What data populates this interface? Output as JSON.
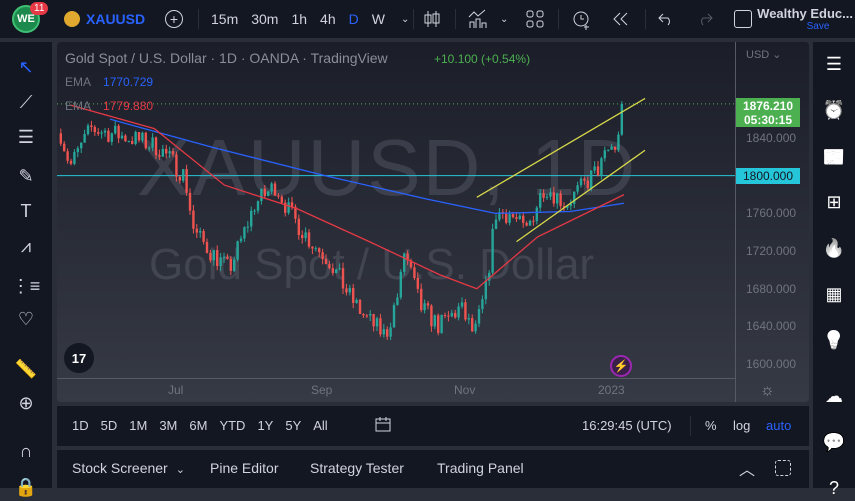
{
  "topbar": {
    "notification_count": "11",
    "symbol": "XAUUSD",
    "intervals": [
      "15m",
      "30m",
      "1h",
      "4h",
      "D",
      "W"
    ],
    "active_interval": "D",
    "account": "Wealthy Educ...",
    "save": "Save"
  },
  "legend": {
    "title": "Gold Spot / U.S. Dollar · 1D · OANDA · TradingView",
    "change": "+10.100 (+0.54%)",
    "ema1_label": "EMA",
    "ema1_value": "1770.729",
    "ema2_label": "EMA",
    "ema2_value": "1779.880"
  },
  "watermark": {
    "symbol": "XAUUSD, 1D",
    "name": "Gold Spot / U.S. Dollar"
  },
  "price_axis": {
    "currency": "USD",
    "current_price": "1876.210",
    "countdown": "05:30:15",
    "hline_label": "1800.000",
    "ticks": [
      "1840.000",
      "1760.000",
      "1720.000",
      "1680.000",
      "1640.000",
      "1600.000"
    ]
  },
  "time_axis": {
    "ticks": [
      "Jul",
      "Sep",
      "Nov",
      "2023"
    ]
  },
  "range_bar": {
    "ranges": [
      "1D",
      "5D",
      "1M",
      "3M",
      "6M",
      "YTD",
      "1Y",
      "5Y",
      "All"
    ],
    "clock": "16:29:45 (UTC)",
    "percent": "%",
    "log": "log",
    "auto": "auto"
  },
  "bottom_tabs": [
    "Stock Screener",
    "Pine Editor",
    "Strategy Tester",
    "Trading Panel"
  ],
  "colors": {
    "up": "#26a69a",
    "down": "#ef5350",
    "ema1": "#2962ff",
    "ema2": "#e53945",
    "channel": "#d8d84a",
    "hline": "#26c6da",
    "accent": "#2962ff",
    "price_badge": "#4caf50"
  },
  "chart_data": {
    "type": "candlestick",
    "symbol": "XAUUSD",
    "timeframe": "1D",
    "ylim": [
      1600,
      1890
    ],
    "approx_close_path": [
      [
        "2022-05-11",
        1845
      ],
      [
        "2022-05-15",
        1810
      ],
      [
        "2022-05-24",
        1850
      ],
      [
        "2022-06-10",
        1840
      ],
      [
        "2022-06-22",
        1830
      ],
      [
        "2022-07-03",
        1800
      ],
      [
        "2022-07-07",
        1740
      ],
      [
        "2022-07-14",
        1720
      ],
      [
        "2022-07-22",
        1700
      ],
      [
        "2022-07-27",
        1730
      ],
      [
        "2022-08-02",
        1770
      ],
      [
        "2022-08-11",
        1790
      ],
      [
        "2022-08-17",
        1760
      ],
      [
        "2022-08-26",
        1730
      ],
      [
        "2022-09-03",
        1710
      ],
      [
        "2022-09-12",
        1670
      ],
      [
        "2022-09-18",
        1650
      ],
      [
        "2022-09-27",
        1630
      ],
      [
        "2022-10-03",
        1680
      ],
      [
        "2022-10-05",
        1720
      ],
      [
        "2022-10-12",
        1660
      ],
      [
        "2022-10-20",
        1640
      ],
      [
        "2022-10-29",
        1660
      ],
      [
        "2022-11-04",
        1630
      ],
      [
        "2022-11-09",
        1680
      ],
      [
        "2022-11-13",
        1760
      ],
      [
        "2022-11-19",
        1760
      ],
      [
        "2022-11-26",
        1740
      ],
      [
        "2022-12-04",
        1790
      ],
      [
        "2022-12-13",
        1770
      ],
      [
        "2022-12-21",
        1790
      ],
      [
        "2022-12-28",
        1810
      ],
      [
        "2023-01-01",
        1830
      ],
      [
        "2023-01-04",
        1830
      ],
      [
        "2023-01-07",
        1876.21
      ]
    ],
    "ema_slow": [
      [
        "2022-06-01",
        1860
      ],
      [
        "2022-07-15",
        1830
      ],
      [
        "2022-09-01",
        1800
      ],
      [
        "2022-10-15",
        1775
      ],
      [
        "2022-11-13",
        1760
      ],
      [
        "2022-12-15",
        1762
      ],
      [
        "2023-01-07",
        1770.729
      ]
    ],
    "ema_fast": [
      [
        "2022-05-15",
        1875
      ],
      [
        "2022-06-20",
        1850
      ],
      [
        "2022-07-20",
        1790
      ],
      [
        "2022-08-20",
        1765
      ],
      [
        "2022-09-20",
        1730
      ],
      [
        "2022-10-20",
        1695
      ],
      [
        "2022-11-05",
        1680
      ],
      [
        "2022-12-01",
        1735
      ],
      [
        "2023-01-07",
        1779.88
      ]
    ],
    "channel_upper": [
      [
        "2022-11-05",
        1777
      ],
      [
        "2023-01-16",
        1882
      ]
    ],
    "channel_lower": [
      [
        "2022-11-22",
        1730
      ],
      [
        "2023-01-16",
        1827
      ]
    ],
    "hline": 1800
  }
}
